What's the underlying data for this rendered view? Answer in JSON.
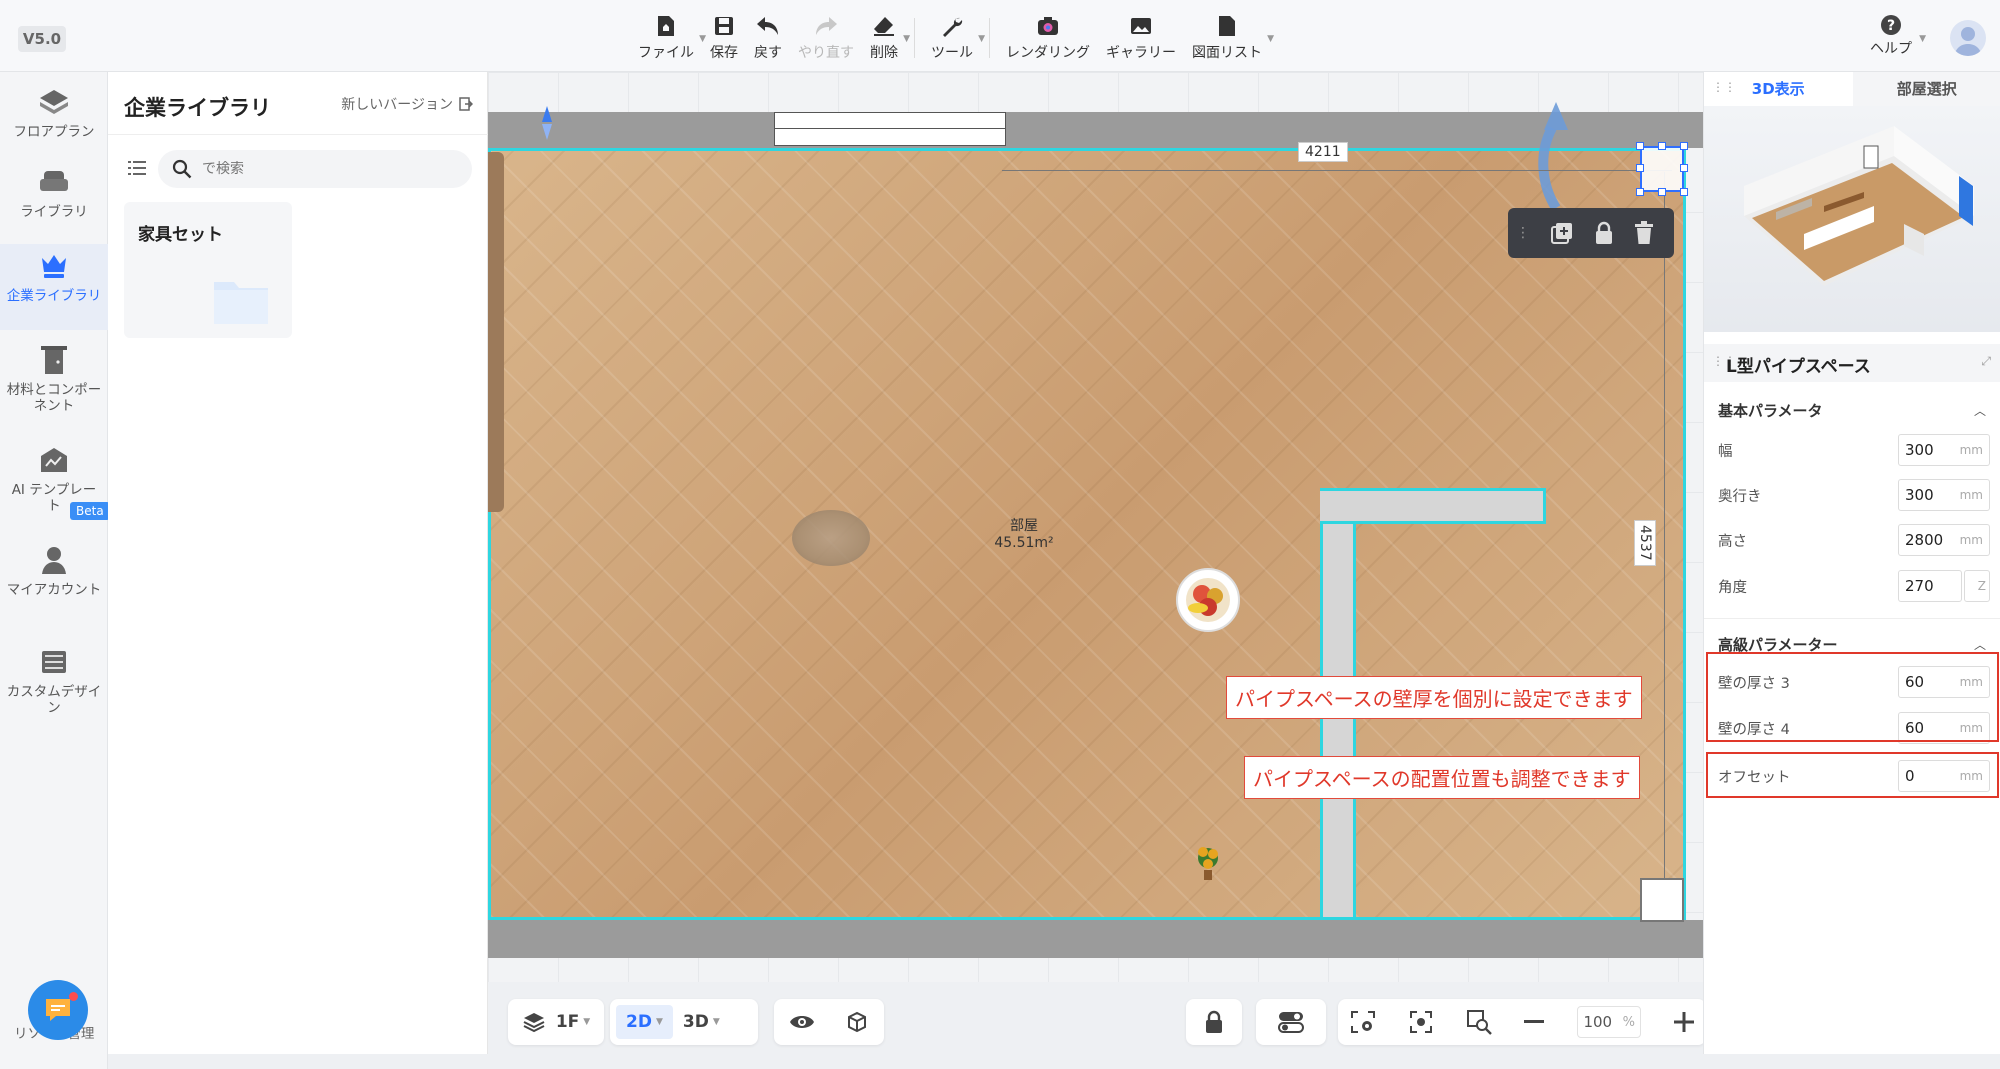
{
  "version": "V5.0",
  "toolbar": {
    "items": [
      {
        "label": "ファイル",
        "icon": "file-home-icon",
        "caret": true
      },
      {
        "label": "保存",
        "icon": "save-icon",
        "caret": false
      },
      {
        "label": "戻す",
        "icon": "undo-icon",
        "caret": false
      },
      {
        "label": "やり直す",
        "icon": "redo-icon",
        "caret": false,
        "disabled": true
      },
      {
        "label": "削除",
        "icon": "eraser-icon",
        "caret": true
      },
      {
        "label": "ツール",
        "icon": "wrench-icon",
        "caret": true
      },
      {
        "label": "レンダリング",
        "icon": "camera-icon",
        "caret": false
      },
      {
        "label": "ギャラリー",
        "icon": "gallery-icon",
        "caret": false
      },
      {
        "label": "図面リスト",
        "icon": "drawing-list-icon",
        "caret": true
      }
    ],
    "help_label": "ヘルプ"
  },
  "leftnav": {
    "items": [
      {
        "label": "フロアプラン",
        "icon": "floorplan-icon"
      },
      {
        "label": "ライブラリ",
        "icon": "sofa-icon"
      },
      {
        "label": "企業ライブラリ",
        "icon": "crown-icon",
        "active": true
      },
      {
        "label": "材料とコンポーネント",
        "icon": "door-icon"
      },
      {
        "label": "AI テンプレート",
        "icon": "ai-template-icon"
      },
      {
        "label": "マイアカウント",
        "icon": "user-icon"
      },
      {
        "label": "カスタムデザイン",
        "icon": "cabinet-icon"
      }
    ],
    "beta_badge": "Beta",
    "bottom_label": "リソース管理"
  },
  "library": {
    "title": "企業ライブラリ",
    "new_version_link": "新しいバージョン",
    "search_placeholder": "で検索",
    "cards": [
      {
        "title": "家具セット"
      }
    ]
  },
  "canvas": {
    "room_name": "部屋",
    "room_area": "45.51m²",
    "dim_horizontal": "4211",
    "dim_vertical": "4537",
    "callouts": [
      "パイプスペースの壁厚を個別に設定できます",
      "パイプスペースの配置位置も調整できます"
    ]
  },
  "bottombar": {
    "floor": "1F",
    "view_2d": "2D",
    "view_3d": "3D",
    "zoom": "100",
    "zoom_unit": "%"
  },
  "rightpanel": {
    "tabs": [
      "3D表示",
      "部屋選択"
    ],
    "active_tab": 0,
    "object_title": "L型パイプスペース",
    "basic_section": "基本パラメータ",
    "basic_params": [
      {
        "label": "幅",
        "value": "300",
        "unit": "mm"
      },
      {
        "label": "奥行き",
        "value": "300",
        "unit": "mm"
      },
      {
        "label": "高さ",
        "value": "2800",
        "unit": "mm"
      },
      {
        "label": "角度",
        "value": "270",
        "unit": "Z"
      }
    ],
    "advanced_section": "高級パラメーター",
    "advanced_params": [
      {
        "label": "壁の厚さ 3",
        "value": "60",
        "unit": "mm"
      },
      {
        "label": "壁の厚さ 4",
        "value": "60",
        "unit": "mm"
      },
      {
        "label": "オフセット",
        "value": "0",
        "unit": "mm"
      }
    ]
  },
  "colors": {
    "accent": "#2b6fff",
    "selection": "#2ed6e0",
    "callout_red": "#e0382a"
  }
}
